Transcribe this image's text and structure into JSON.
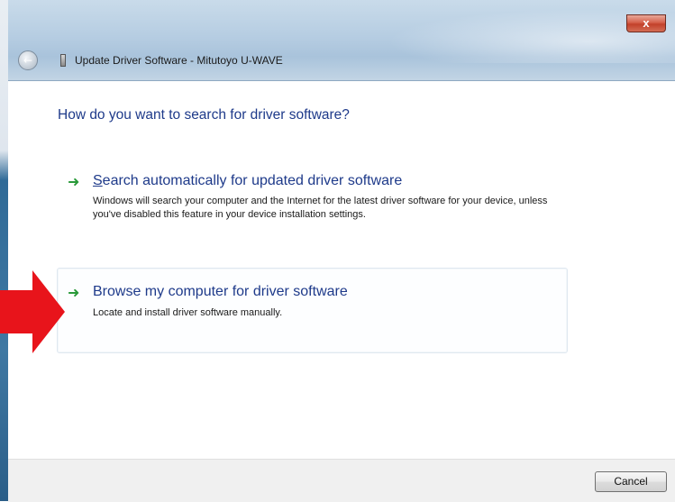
{
  "window": {
    "title": "Update Driver Software - Mitutoyo U-WAVE",
    "close_label": "x",
    "back_icon": "back-arrow-icon"
  },
  "main": {
    "heading": "How do you want to search for driver software?",
    "options": [
      {
        "accel": "S",
        "title_rest": "earch automatically for updated driver software",
        "description": "Windows will search your computer and the Internet for the latest driver software for your device, unless you've disabled this feature in your device installation settings.",
        "icon": "green-arrow-icon"
      },
      {
        "title": "Browse my computer for driver software",
        "description": "Locate and install driver software manually.",
        "icon": "green-arrow-icon"
      }
    ]
  },
  "annotation": {
    "icon": "red-arrow-icon",
    "color": "#e8141b"
  },
  "footer": {
    "cancel_label": "Cancel"
  },
  "colors": {
    "link_blue": "#1e3a8a",
    "arrow_green": "#2a9a3a"
  }
}
